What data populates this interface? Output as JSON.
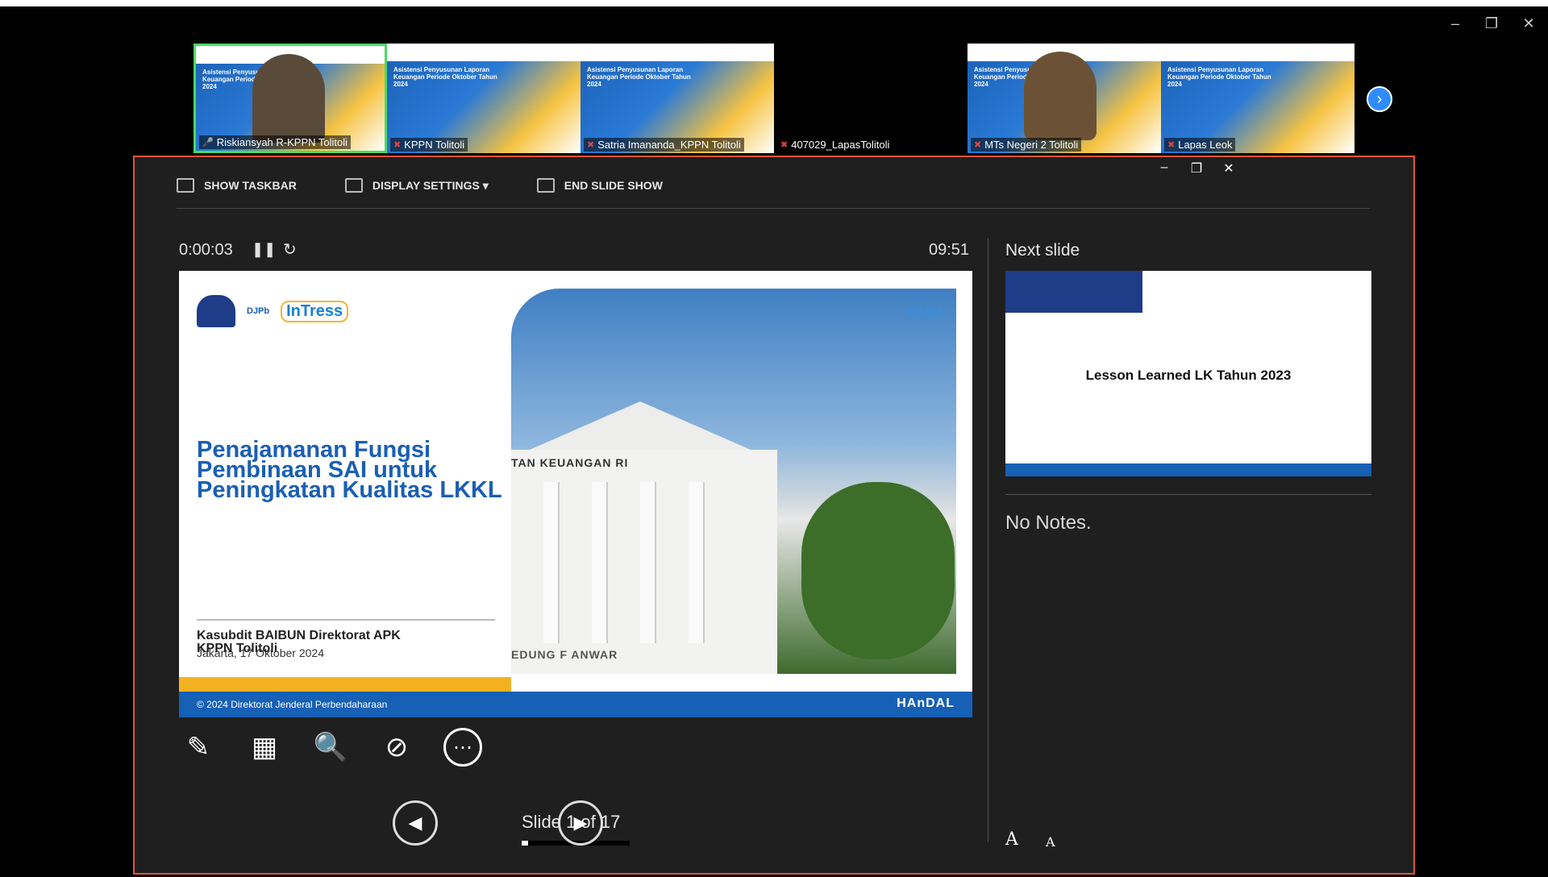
{
  "window_controls": {
    "minimize": "–",
    "restore": "❐",
    "close": "✕"
  },
  "gallery": {
    "participants": [
      {
        "name": "Riskiansyah R-KPPN Tolitoli",
        "active": true,
        "has_video": true,
        "banner_title": "Asistensi Penyusunan Laporan Keuangan Periode Oktober Tahun 2024"
      },
      {
        "name": "KPPN Tolitoli",
        "active": false,
        "has_video": false,
        "banner_title": "Asistensi Penyusunan Laporan Keuangan Periode Oktober Tahun 2024"
      },
      {
        "name": "Satria Imananda_KPPN Tolitoli",
        "active": false,
        "has_video": false,
        "banner_title": "Asistensi Penyusunan Laporan Keuangan Periode Oktober Tahun 2024"
      },
      {
        "name": "407029_LapasTolitoli",
        "active": false,
        "black": true
      },
      {
        "name": "MTs Negeri 2 Tolitoli",
        "active": false,
        "has_video": true,
        "banner_title": "Asistensi Penyusunan Laporan Keuangan Periode Oktober Tahun 2024"
      },
      {
        "name": "Lapas Leok",
        "active": false,
        "has_video": false,
        "banner_title": "Asistensi Penyusunan Laporan Keuangan Periode Oktober Tahun 2024"
      }
    ],
    "next_icon": "chevron-right-icon"
  },
  "presenter": {
    "toolbar": {
      "show_taskbar": "SHOW TASKBAR",
      "display_settings": "DISPLAY SETTINGS ▾",
      "end_slide_show": "END SLIDE SHOW"
    },
    "timer": "0:00:03",
    "clock": "09:51",
    "slide": {
      "title": "Penajamanan Fungsi Pembinaan SAI untuk Peningkatan Kualitas LKKL",
      "subtitle_1": "Kasubdit BAIBUN Direktorat APK",
      "subtitle_2": "KPPN Tolitoli",
      "date": "Jakarta, 17 Oktober 2024",
      "logo_djpb": "DJPb",
      "logo_intress": "InTress",
      "satu_logo": "satu",
      "building_sign": "TAN KEUANGAN RI",
      "building_sign_2": "EDUNG  F ANWAR",
      "footer_text": "© 2024 Direktorat Jenderal Perbendaharaan",
      "footer_brand": "HAnDAL"
    },
    "slide_counter": "Slide 1 of 17",
    "progress_fraction": 0.0588,
    "next_slide_label": "Next slide",
    "next_slide_text": "Lesson Learned LK Tahun 2023",
    "notes": "No Notes."
  }
}
